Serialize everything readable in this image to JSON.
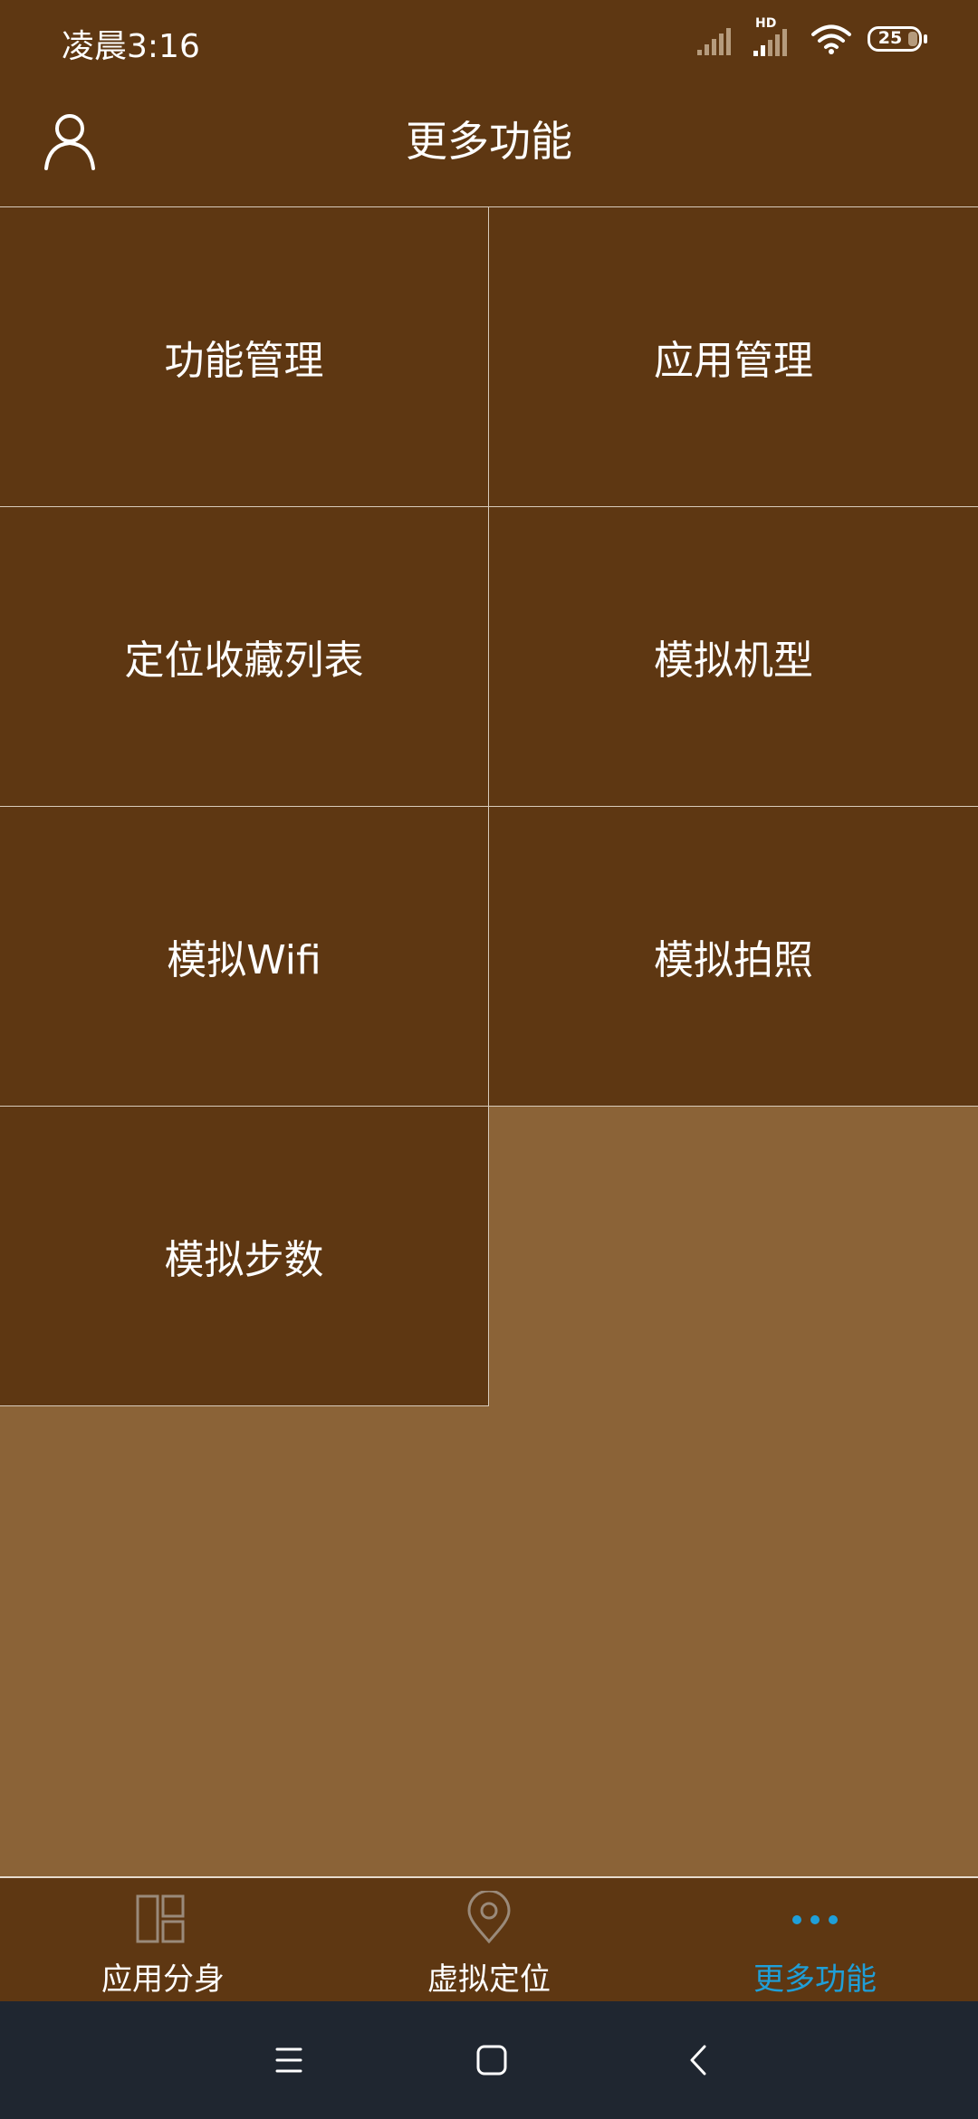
{
  "status_bar": {
    "time": "凌晨3:16",
    "hd_label": "HD",
    "battery": "25"
  },
  "header": {
    "title": "更多功能"
  },
  "features": [
    {
      "label": "功能管理"
    },
    {
      "label": "应用管理"
    },
    {
      "label": "定位收藏列表"
    },
    {
      "label": "模拟机型"
    },
    {
      "label": "模拟Wifi"
    },
    {
      "label": "模拟拍照"
    },
    {
      "label": "模拟步数"
    }
  ],
  "bottom_nav": {
    "items": [
      {
        "label": "应用分身",
        "icon": "split-layout-icon"
      },
      {
        "label": "虚拟定位",
        "icon": "location-pin-icon"
      },
      {
        "label": "更多功能",
        "icon": "more-dots-icon"
      }
    ],
    "active_index": 2
  },
  "colors": {
    "bar": "#5E3712",
    "background": "#8B6337",
    "active": "#1F9FD8",
    "system_nav": "#1F2630"
  }
}
